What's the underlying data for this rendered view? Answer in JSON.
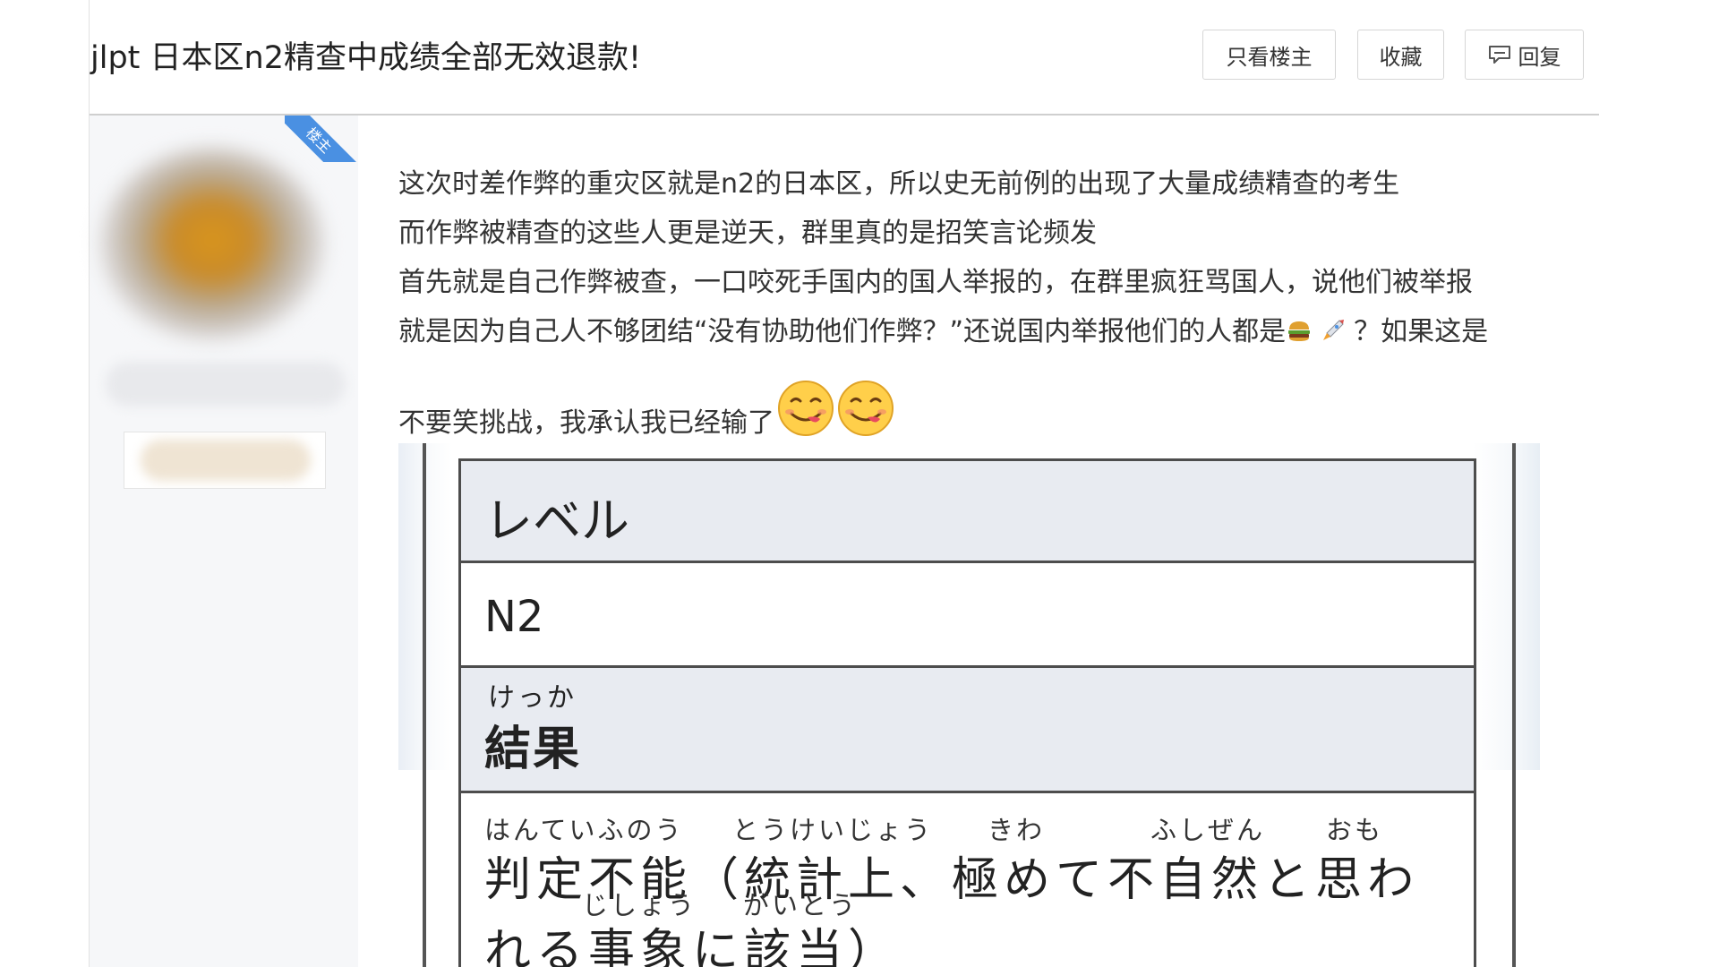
{
  "thread": {
    "title": "jlpt 日本区n2精查中成绩全部无效退款!",
    "buttons": {
      "only_op": "只看楼主",
      "favorite": "收藏",
      "reply": "回复"
    }
  },
  "author": {
    "op_badge": "楼主"
  },
  "post": {
    "lines": [
      "这次时差作弊的重灾区就是n2的日本区，所以史无前例的出现了大量成绩精查的考生",
      "而作弊被精查的这些人更是逆天，群里真的是招笑言论频发",
      "首先就是自己作弊被查，一口咬死手国内的国人举报的，在群里疯狂骂国人，说他们被举报",
      "就是因为自己人不够团结“没有协助他们作弊？”还说国内举报他们的人都是",
      "？如果这是",
      "不要笑挑战，我承认我已经输了"
    ],
    "inline_icons": [
      "hamburger-icon",
      "rocket-icon"
    ],
    "emojis": [
      "yum-face-emoji",
      "yum-face-emoji"
    ]
  },
  "image": {
    "header_level": "レベル",
    "level_value": "N2",
    "result_ruby": "けっか",
    "result_label": "結果",
    "detail_line1": "判定不能（統計上、極めて不自然と思わ",
    "detail_line2": "れる事象に該当）",
    "ruby": {
      "r1": "はんていふのう",
      "r2": "とうけいじょう",
      "r3": "きわ",
      "r4": "ふしぜん",
      "r5": "おも",
      "r6": "じしょう",
      "r7": "がいとう"
    }
  },
  "colors": {
    "op_badge": "#4a90e2",
    "table_header_bg": "#e8ebf1",
    "divider": "#cfcfcf"
  }
}
